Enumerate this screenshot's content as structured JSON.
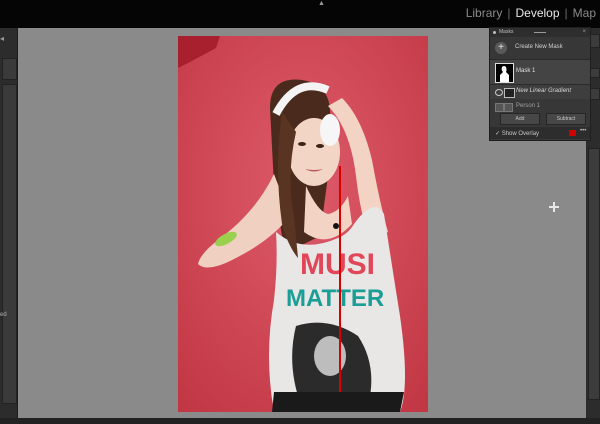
{
  "topbar": {
    "modules": [
      "Library",
      "Develop",
      "Map"
    ],
    "active_module": "Develop",
    "separator": "|",
    "collapse_arrow": "▲"
  },
  "left_panel": {
    "collapse_arrow": "◂",
    "cut_label": "ed"
  },
  "masks_panel": {
    "title": "Masks",
    "close_icon": "×",
    "create_label": "Create New Mask",
    "create_icon": "+",
    "mask_name": "Mask 1",
    "component_label": "New Linear Gradient",
    "component_sub": "Person 1",
    "add_label": "Add",
    "subtract_label": "Subtract",
    "overlay_label": "✓ Show Overlay",
    "overlay_color": "#d00000",
    "more_icon": "•••"
  },
  "photo": {
    "background_color": "#d6495a",
    "shirt_text_line1": "MUSI",
    "shirt_text_line2": "MATTER"
  },
  "colors": {
    "canvas": "#8a8a8a",
    "panel": "#373737",
    "topbar": "#050505"
  }
}
